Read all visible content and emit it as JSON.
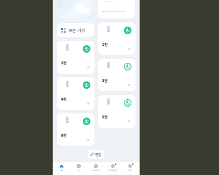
{
  "header": {
    "hero_right_text": "-- ---- --",
    "accent": "#23c28a",
    "nav_active": "#2a7fe0"
  },
  "all_devices": {
    "label": "모든 기기"
  },
  "devices": [
    {
      "name": "1번",
      "power": "on"
    },
    {
      "name": "2번",
      "power": "on"
    },
    {
      "name": "3번",
      "power": "off"
    },
    {
      "name": "4번",
      "power": "on"
    },
    {
      "name": "5번",
      "power": "off"
    },
    {
      "name": "6번",
      "power": "on"
    }
  ],
  "edit_button": {
    "label": "편집",
    "icon": "pencil-icon"
  },
  "bottom_nav": [
    {
      "label": "홈",
      "icon": "home-icon"
    },
    {
      "label": "방",
      "icon": "room-icon"
    },
    {
      "label": "시나리오",
      "icon": "scenario-icon"
    },
    {
      "label": "스마트공간",
      "icon": "smart-space-icon"
    },
    {
      "label": "설정",
      "icon": "settings-icon"
    }
  ]
}
